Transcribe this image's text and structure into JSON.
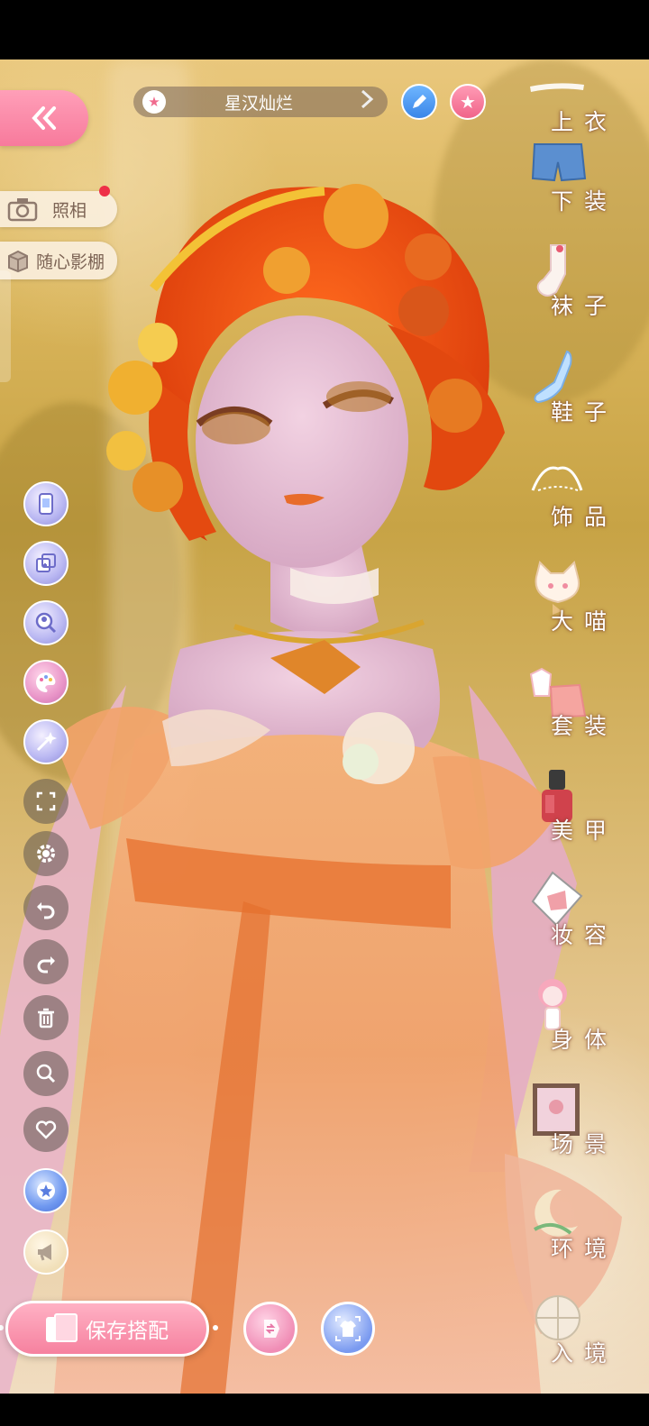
{
  "header": {
    "outfit_name": "星汉灿烂"
  },
  "left_buttons": {
    "photo_label": "照相",
    "studio_label": "随心影棚"
  },
  "tools": [
    {
      "icon": "phone-screen-icon",
      "style": "fancy"
    },
    {
      "icon": "compare-icon",
      "style": "fancy"
    },
    {
      "icon": "search-person-icon",
      "style": "fancy"
    },
    {
      "icon": "palette-icon",
      "style": "pink"
    },
    {
      "icon": "magic-wand-icon",
      "style": "fancy"
    },
    {
      "icon": "fullscreen-icon",
      "style": "gray"
    },
    {
      "icon": "gear-icon",
      "style": "gray"
    },
    {
      "icon": "undo-icon",
      "style": "gray"
    },
    {
      "icon": "redo-icon",
      "style": "gray"
    },
    {
      "icon": "trash-icon",
      "style": "gray"
    },
    {
      "icon": "magnifier-icon",
      "style": "gray"
    },
    {
      "icon": "heart-icon",
      "style": "gray"
    },
    {
      "icon": "star-badge-icon",
      "style": "blue"
    },
    {
      "icon": "megaphone-icon",
      "style": "cream"
    }
  ],
  "bottom": {
    "save_label": "保存搭配"
  },
  "categories": [
    {
      "label": "上衣",
      "icon": "top-clothing-icon"
    },
    {
      "label": "下装",
      "icon": "shorts-icon"
    },
    {
      "label": "袜子",
      "icon": "sock-icon"
    },
    {
      "label": "鞋子",
      "icon": "shoe-icon"
    },
    {
      "label": "饰品",
      "icon": "tiara-icon"
    },
    {
      "label": "大喵",
      "icon": "cat-icon"
    },
    {
      "label": "套装",
      "icon": "outfit-set-icon"
    },
    {
      "label": "美甲",
      "icon": "nail-polish-icon"
    },
    {
      "label": "妆容",
      "icon": "makeup-icon"
    },
    {
      "label": "身体",
      "icon": "body-icon"
    },
    {
      "label": "场景",
      "icon": "scene-icon"
    },
    {
      "label": "环境",
      "icon": "environment-icon"
    },
    {
      "label": "入境",
      "icon": "entry-icon"
    }
  ],
  "colors": {
    "accent_pink": "#f6819f",
    "accent_blue": "#3a86e8",
    "notification_red": "#ee3048"
  }
}
